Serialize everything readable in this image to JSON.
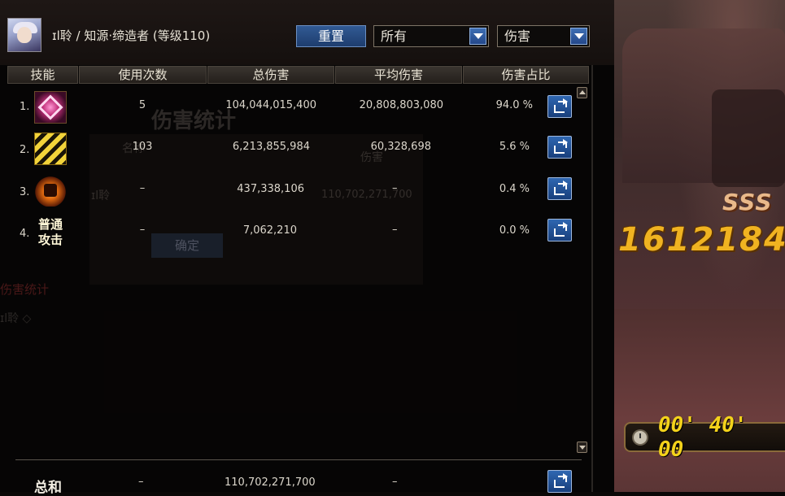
{
  "scene": {
    "rank": "SSS",
    "combo_value": "1612184",
    "timer": "00' 40' 00"
  },
  "ghost_dialog": {
    "title": "伤害统计",
    "col_a": "名称",
    "col_b": "伤害",
    "name": "ɪl聆",
    "total": "110,702,271,700",
    "confirm": "确定",
    "red_label": "伤害统计",
    "name2": "ɪl聆 ◇"
  },
  "header": {
    "character_title": "ɪl聆 / 知源·缔造者 (等级110)",
    "reset_label": "重置",
    "filter_target": "所有",
    "filter_metric": "伤害"
  },
  "columns": {
    "skill": "技能",
    "uses": "使用次数",
    "total_damage": "总伤害",
    "avg_damage": "平均伤害",
    "damage_share": "伤害占比"
  },
  "rows": [
    {
      "index": "1.",
      "uses": "5",
      "total": "104,044,015,400",
      "avg": "20,808,803,080",
      "share": "94.0 %",
      "icon": "magic-seal-skill-icon"
    },
    {
      "index": "2.",
      "uses": "103",
      "total": "6,213,855,984",
      "avg": "60,328,698",
      "share": "5.6 %",
      "icon": "lightning-burst-skill-icon"
    },
    {
      "index": "3.",
      "uses": "–",
      "total": "437,338,106",
      "avg": "–",
      "share": "0.4 %",
      "icon": "fire-emblem-skill-icon"
    },
    {
      "index": "4.",
      "uses": "–",
      "total": "7,062,210",
      "avg": "–",
      "share": "0.0 %",
      "icon": "normal-attack-icon",
      "icon_text_1": "普通",
      "icon_text_2": "攻击"
    }
  ],
  "total": {
    "label": "总和",
    "uses": "–",
    "total": "110,702,271,700",
    "avg": "–"
  }
}
